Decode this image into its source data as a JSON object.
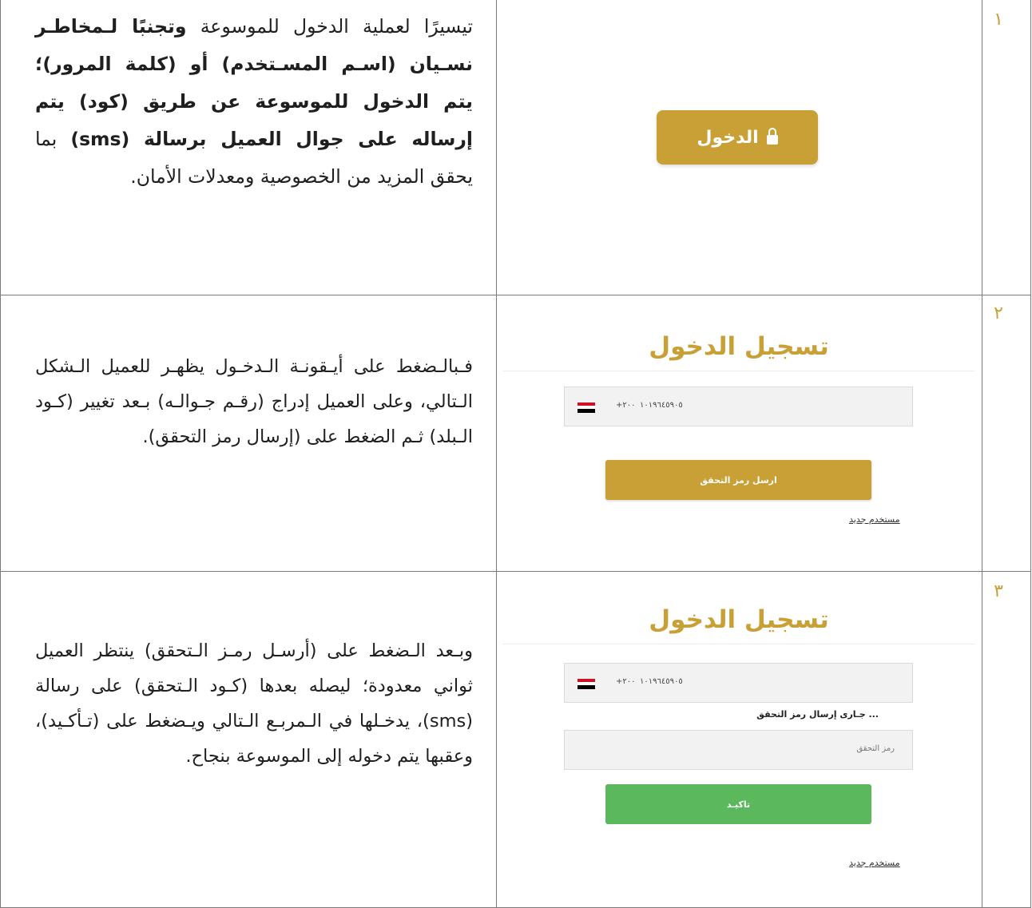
{
  "rows": [
    {
      "number": "١",
      "segments": [
        {
          "text": "تيسيرًا لعملية الدخول للموسوعة ",
          "bold": false
        },
        {
          "text": "وتجنبًا لـمخاطـر نسـيان (اسـم المسـتخدم) أو (كلمة المرور)؛ يتم الدخول للموسوعة عن طريق (كود) يتم إرساله على جوال العميل برسالة (sms)",
          "bold": true
        },
        {
          "text": " بما يحقق المزيد من الخصوصية ومعدلات الأمان.",
          "bold": false
        }
      ],
      "button_label": "الدخول"
    },
    {
      "number": "٢",
      "description": "فـبالـضغط على أيـقونـة الـدخـول يظهـر للعميل الـشكل الـتالي، وعلى العميل إدراج (رقـم جـوالـه) بـعد تغيير (كـود الـبلد) ثـم الضغط على (إرسال رمز التحقق).",
      "card": {
        "title": "تسجيل الدخول",
        "country_code": "+٢٠٠",
        "phone_number": "١٠١٩٦٤٥٩٠٥",
        "send_button": "ارسل رمز التحقق",
        "new_user_link": "مستخدم جديد"
      }
    },
    {
      "number": "٣",
      "description": "وبـعد الـضغط على (أرسـل رمـز الـتحقق) ينتظر العميل ثواني معدودة؛ ليصله بعدها (كـود الـتحقق) على رسالة (sms)، يدخـلها في الـمربـع الـتالي ويـضغط على (تـأكـيد)، وعقبها يتم دخوله إلى الموسوعة بنجاح.",
      "card": {
        "title": "تسجيل الدخول",
        "country_code": "+٢٠٠",
        "phone_number": "١٠١٩٦٤٥٩٠٥",
        "sending_text": "... جـارى إرسال رمز التحقق",
        "otp_placeholder": "رمز التحقق",
        "confirm_button": "تاكيـد",
        "new_user_link": "مستخدم جديد"
      }
    }
  ],
  "colors": {
    "gold": "#c9a036",
    "green": "#5cb85c",
    "flag_red": "#ce1126",
    "flag_black": "#000000"
  }
}
